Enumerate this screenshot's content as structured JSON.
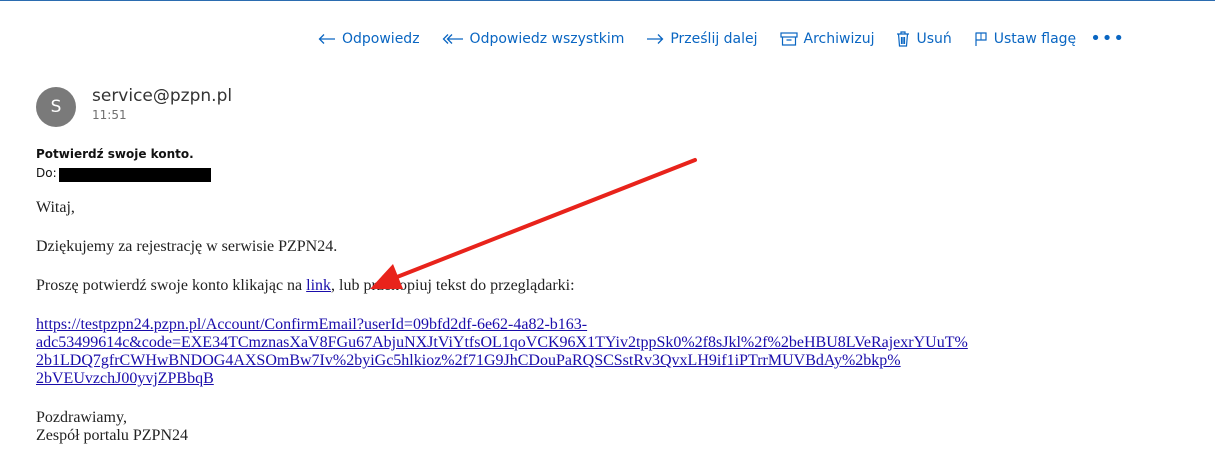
{
  "toolbar": {
    "reply": "Odpowiedz",
    "reply_all": "Odpowiedz wszystkim",
    "forward": "Prześlij dalej",
    "archive": "Archiwizuj",
    "delete": "Usuń",
    "flag": "Ustaw flagę",
    "more": "•••"
  },
  "message": {
    "avatar_initial": "S",
    "sender": "service@pzpn.pl",
    "time": "11:51",
    "subject": "Potwierdź swoje konto.",
    "to_label": "Do:",
    "greeting": "Witaj,",
    "thanks": "Dziękujemy za rejestrację w serwisie PZPN24.",
    "confirm_before": "Proszę potwierdź swoje konto klikając na ",
    "confirm_link": "link",
    "confirm_after": ", lub przekopiuj tekst do przeglądarki:",
    "url": "https://testpzpn24.pzpn.pl/Account/ConfirmEmail?userId=09bfd2df-6e62-4a82-b163-adc53499614c&code=EXE34TCmznasXaV8FGu67AbjuNXJtViYtfsOL1qoVCK96X1TYiv2tppSk0%2f8sJkl%2f%2beHBU8LVeRajexrYUuT%2b1LDQ7gfrCWHwBNDOG4AXSOmBw7Iv%2byiGc5hlkioz%2f71G9JhCDouPaRQSCSstRv3QvxLH9if1iPTrrMUVBdAy%2bkp%2bVEUvzchJ00yvjZPBbqB",
    "url_lines": [
      "https://testpzpn24.pzpn.pl/Account/ConfirmEmail?userId=09bfd2df-6e62-4a82-b163-",
      "adc53499614c&code=EXE34TCmznasXaV8FGu67AbjuNXJtViYtfsOL1qoVCK96X1TYiv2tppSk0%2f8sJkl%2f%2beHBU8LVeRajexrYUuT%",
      "2b1LDQ7gfrCWHwBNDOG4AXSOmBw7Iv%2byiGc5hlkioz%2f71G9JhCDouPaRQSCSstRv3QvxLH9if1iPTrrMUVBdAy%2bkp%",
      "2bVEUvzchJ00yvjZPBbqB"
    ],
    "closing": "Pozdrawiamy,",
    "team": "Zespół portalu PZPN24"
  },
  "colors": {
    "accent": "#0a66c2",
    "annotation_arrow": "#e8231b",
    "avatar": "#7a7a7a"
  },
  "icons": [
    "arrow-left-icon",
    "double-arrow-left-icon",
    "arrow-right-icon",
    "archive-icon",
    "trash-icon",
    "flag-icon",
    "more-icon"
  ]
}
